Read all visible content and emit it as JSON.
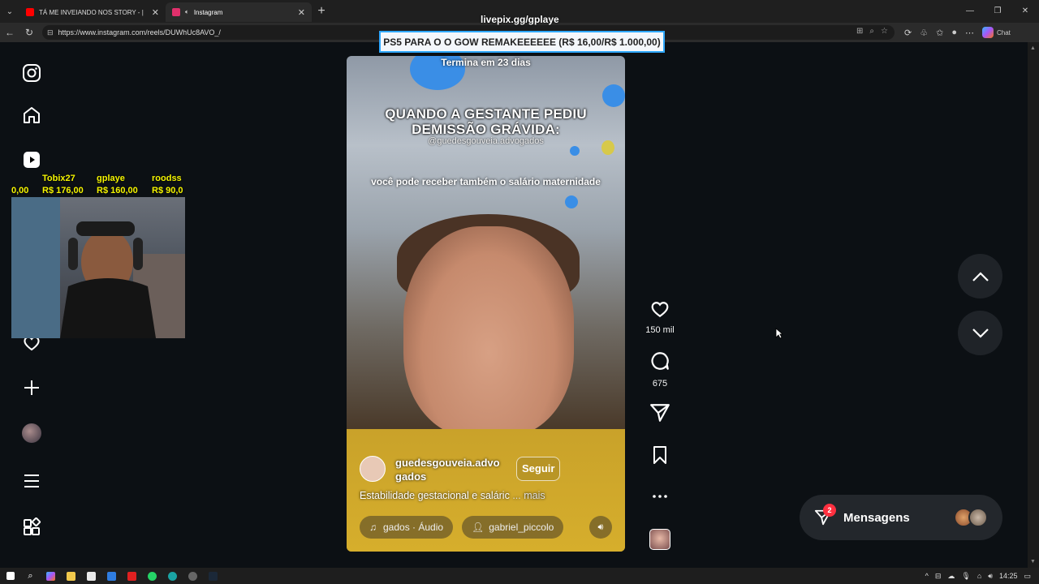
{
  "browser": {
    "tabs": [
      {
        "title": "TÁ ME INVEIANDO NOS STORY - |",
        "favicon_color": "#ff0000",
        "active": false
      },
      {
        "title": "Instagram",
        "favicon_color": "#e1306c",
        "active": true
      }
    ],
    "url": "https://www.instagram.com/reels/DUWhUc8AVO_/",
    "chat_label": "Chat"
  },
  "overlay": {
    "livepix": "livepix.gg/gplaye",
    "donation_banner": "PS5 PARA O O GOW REMAKEEEEEE (R$ 16,00/R$ 1.000,00)",
    "donors": [
      {
        "name": "Tobix27",
        "amount": "R$ 176,00"
      },
      {
        "name": "gplaye",
        "amount": "R$ 160,00"
      },
      {
        "name": "roodss",
        "amount": "R$ 90,0"
      }
    ],
    "donor_prev_amount": "0,00"
  },
  "sidebar": {
    "icons": [
      "instagram-logo-icon",
      "home-icon",
      "reels-icon",
      "notifications-heart-icon",
      "create-plus-icon",
      "profile-avatar",
      "more-menu-icon",
      "also-from-meta-icon"
    ]
  },
  "reel": {
    "countdown": "Termina em 23 dias",
    "headline": "QUANDO A GESTANTE PEDIU DEMISSÃO GRÁVIDA:",
    "handle_overlay": "@guedesgouveia.advogados",
    "caption_overlay": "você pode receber também o salário maternidade",
    "author_line1": "guedesgouveia.advo",
    "author_line2": "gados",
    "follow_label": "Seguir",
    "description": "Estabilidade gestacional e saláric",
    "more_label": "... mais",
    "audio": "gados · Áudio",
    "tagged_user": "gabriel_piccolo"
  },
  "actions": {
    "likes": "150 mil",
    "comments": "675"
  },
  "messages": {
    "label": "Mensagens",
    "badge": "2"
  },
  "taskbar": {
    "time": "14:25"
  },
  "colors": {
    "background": "#0c1014",
    "donation_border": "#2fa8ff",
    "donor_text": "#f5f500",
    "badge": "#ff3040"
  }
}
